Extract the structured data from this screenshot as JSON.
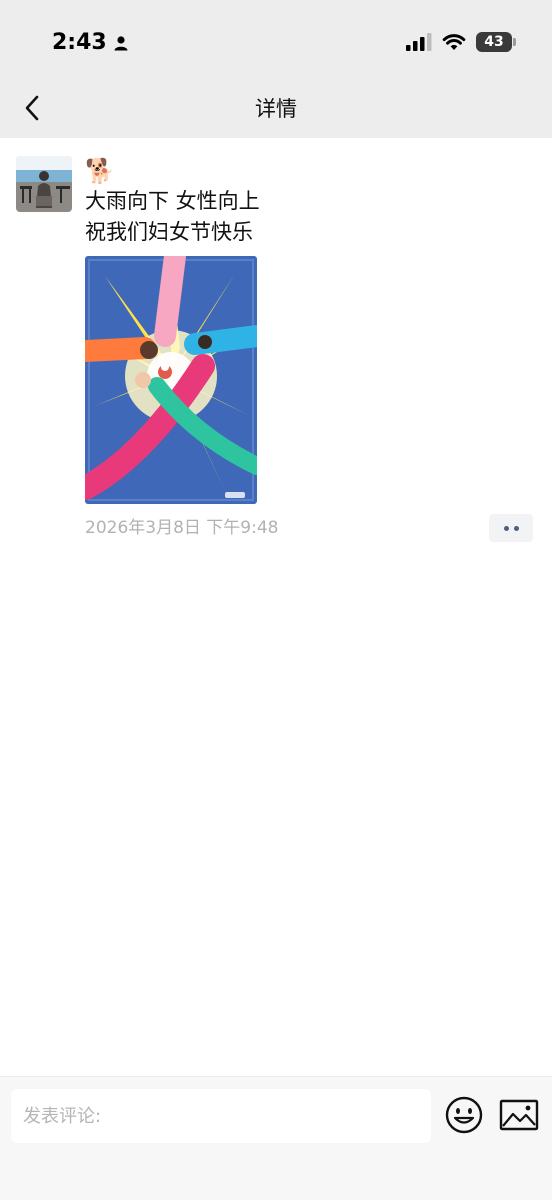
{
  "status_bar": {
    "time": "2:43",
    "battery": "43"
  },
  "nav": {
    "title": "详情"
  },
  "post": {
    "emoji": "🐕",
    "lines": [
      "大雨向下 女性向上",
      "祝我们妇女节快乐"
    ],
    "timestamp": "2026年3月8日 下午9:48"
  },
  "comment_bar": {
    "placeholder": "发表评论:"
  },
  "colors": {
    "nav_bg": "#ededed",
    "timestamp": "#b2b2b2",
    "more_dots": "#4a5f86",
    "poster_bg": "#3f68b8"
  },
  "icons": {
    "back": "chevron-left-icon",
    "person": "person-icon",
    "signal": "signal-icon",
    "wifi": "wifi-icon",
    "emoji": "smiley-icon",
    "image": "image-icon"
  }
}
